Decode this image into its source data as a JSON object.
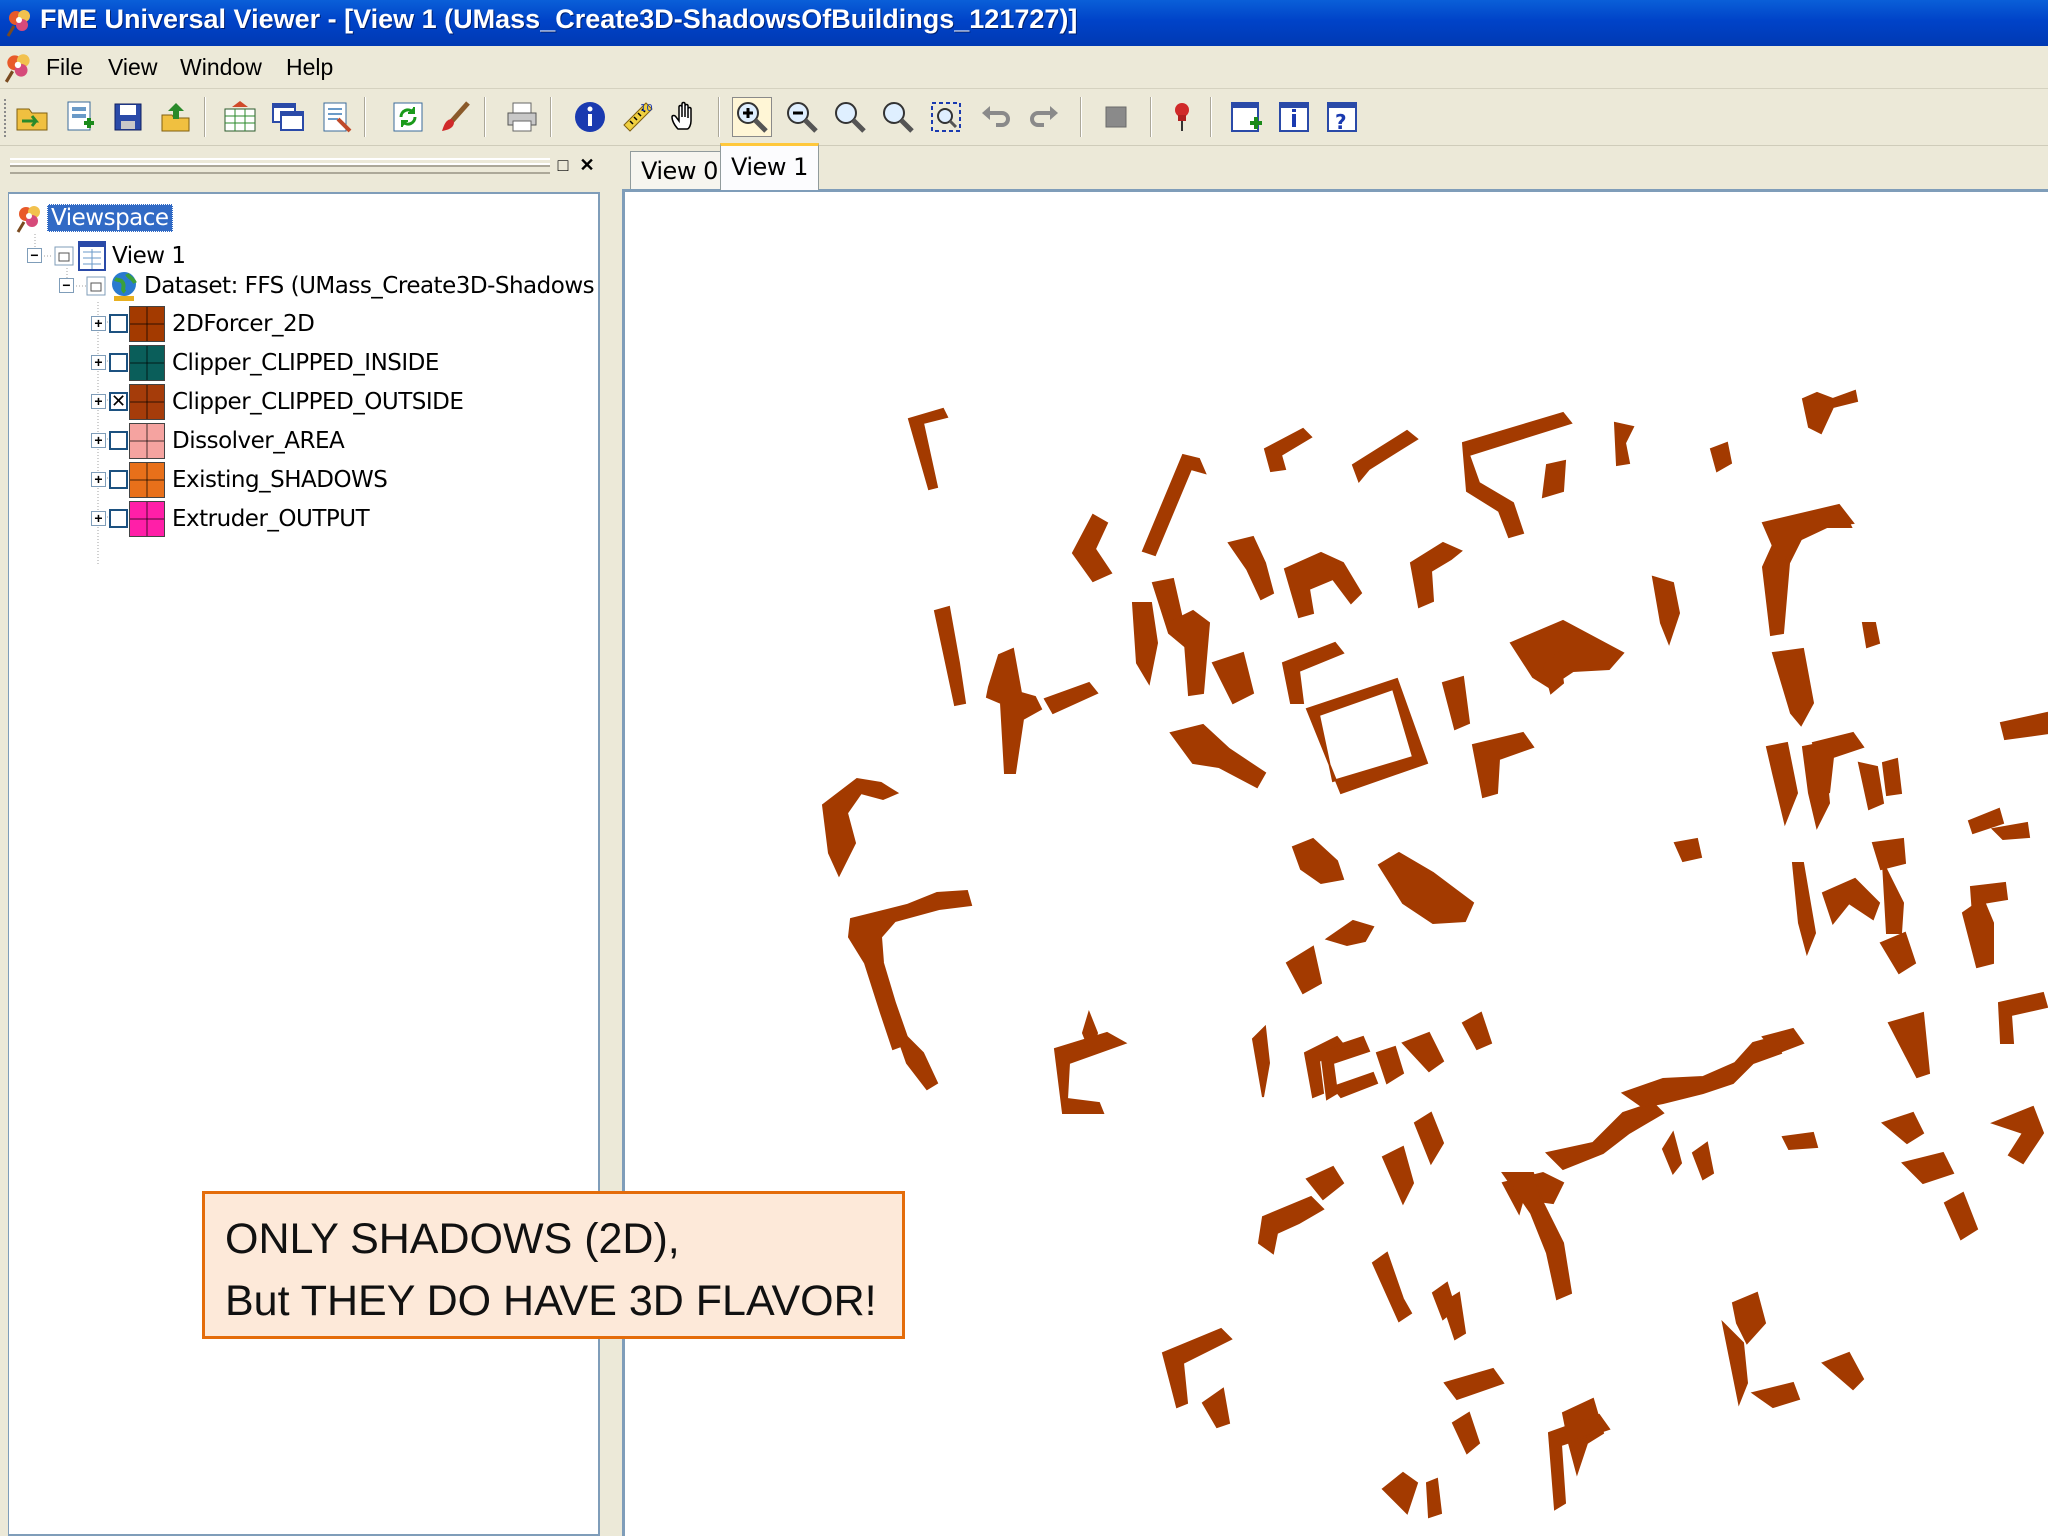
{
  "window": {
    "title": "FME Universal Viewer - [View 1 (UMass_Create3D-ShadowsOfBuildings_121727)]",
    "app_icon": "fme-flower-icon"
  },
  "menu": {
    "items": [
      "File",
      "View",
      "Window",
      "Help"
    ]
  },
  "toolbar": {
    "buttons": [
      {
        "name": "open-dataset-icon"
      },
      {
        "name": "add-dataset-icon"
      },
      {
        "name": "save-icon"
      },
      {
        "name": "export-icon"
      },
      {
        "name": "view-table-icon"
      },
      {
        "name": "windows-icon"
      },
      {
        "name": "properties-icon"
      },
      {
        "name": "refresh-icon"
      },
      {
        "name": "brush-icon"
      },
      {
        "name": "print-icon"
      },
      {
        "name": "info-icon"
      },
      {
        "name": "measure-icon"
      },
      {
        "name": "pan-hand-icon"
      },
      {
        "name": "zoom-in-icon",
        "active": true
      },
      {
        "name": "zoom-out-icon"
      },
      {
        "name": "zoom-icon"
      },
      {
        "name": "zoom-previous-icon"
      },
      {
        "name": "zoom-extents-icon"
      },
      {
        "name": "undo-icon"
      },
      {
        "name": "redo-icon"
      },
      {
        "name": "stop-icon"
      },
      {
        "name": "pin-icon"
      },
      {
        "name": "new-view-icon"
      },
      {
        "name": "query-info-icon"
      },
      {
        "name": "help-icon"
      }
    ]
  },
  "tree": {
    "root_label": "Viewspace",
    "view_label": "View 1",
    "dataset_label": "Dataset: FFS (UMass_Create3D-Shadows",
    "layers": [
      {
        "label": "2DForcer_2D",
        "checked": false,
        "color": "#a33a00"
      },
      {
        "label": "Clipper_CLIPPED_INSIDE",
        "checked": false,
        "color": "#0a5e5a"
      },
      {
        "label": "Clipper_CLIPPED_OUTSIDE",
        "checked": true,
        "color": "#a53c0a"
      },
      {
        "label": "Dissolver_AREA",
        "checked": false,
        "color": "#f5a3a0"
      },
      {
        "label": "Existing_SHADOWS",
        "checked": false,
        "color": "#e8701a"
      },
      {
        "label": "Extruder_OUTPUT",
        "checked": false,
        "color": "#ff1fa8"
      }
    ]
  },
  "tabs": [
    {
      "label": "View 0",
      "active": false
    },
    {
      "label": "View 1",
      "active": true
    }
  ],
  "map": {
    "feature_color": "#a33a00",
    "background": "#ffffff"
  },
  "callout": {
    "line1": "ONLY SHADOWS (2D),",
    "line2": "But THEY DO HAVE 3D FLAVOR!",
    "border_color": "#e46c0a",
    "fill_color": "#fde9d9"
  }
}
